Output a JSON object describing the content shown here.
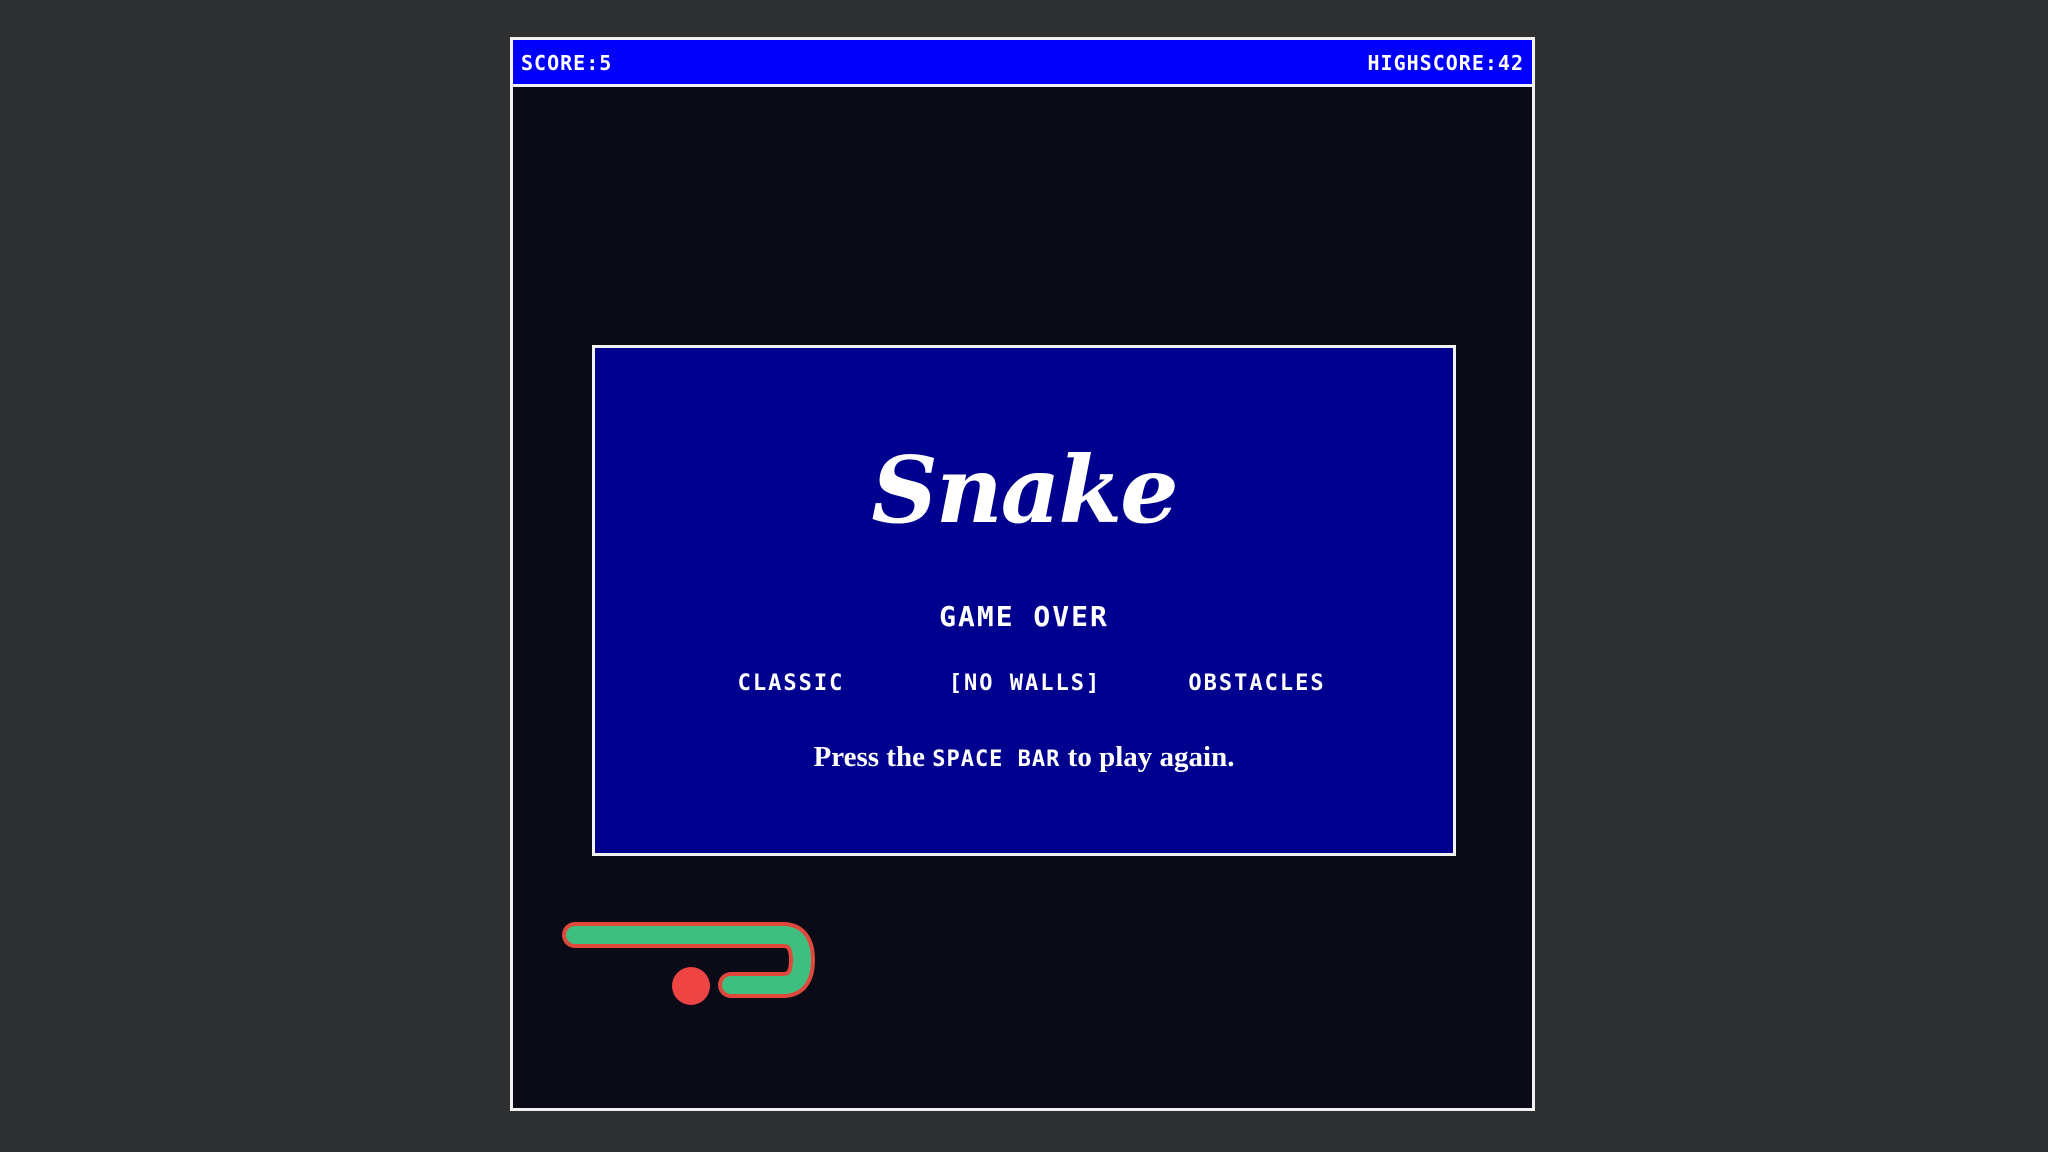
{
  "hud": {
    "score_label": "SCORE:",
    "score_value": "5",
    "highscore_label": "HIGHSCORE:",
    "highscore_value": "42"
  },
  "overlay": {
    "title": "Snake",
    "status": "GAME OVER",
    "modes": [
      {
        "label": "CLASSIC",
        "selected": false
      },
      {
        "label": "[NO WALLS]",
        "selected": true
      },
      {
        "label": "OBSTACLES",
        "selected": false
      }
    ],
    "prompt_before": "Press the ",
    "prompt_key": "SPACE BAR",
    "prompt_after": " to play again."
  },
  "colors": {
    "hud_bar": "#0000fa",
    "overlay_panel": "#00008f",
    "board": "#0b0b18",
    "snake_body": "#3fbf7f",
    "snake_outline": "#e0483c",
    "food": "#ef4444"
  },
  "icons": {
    "food": "red-dot-food"
  }
}
